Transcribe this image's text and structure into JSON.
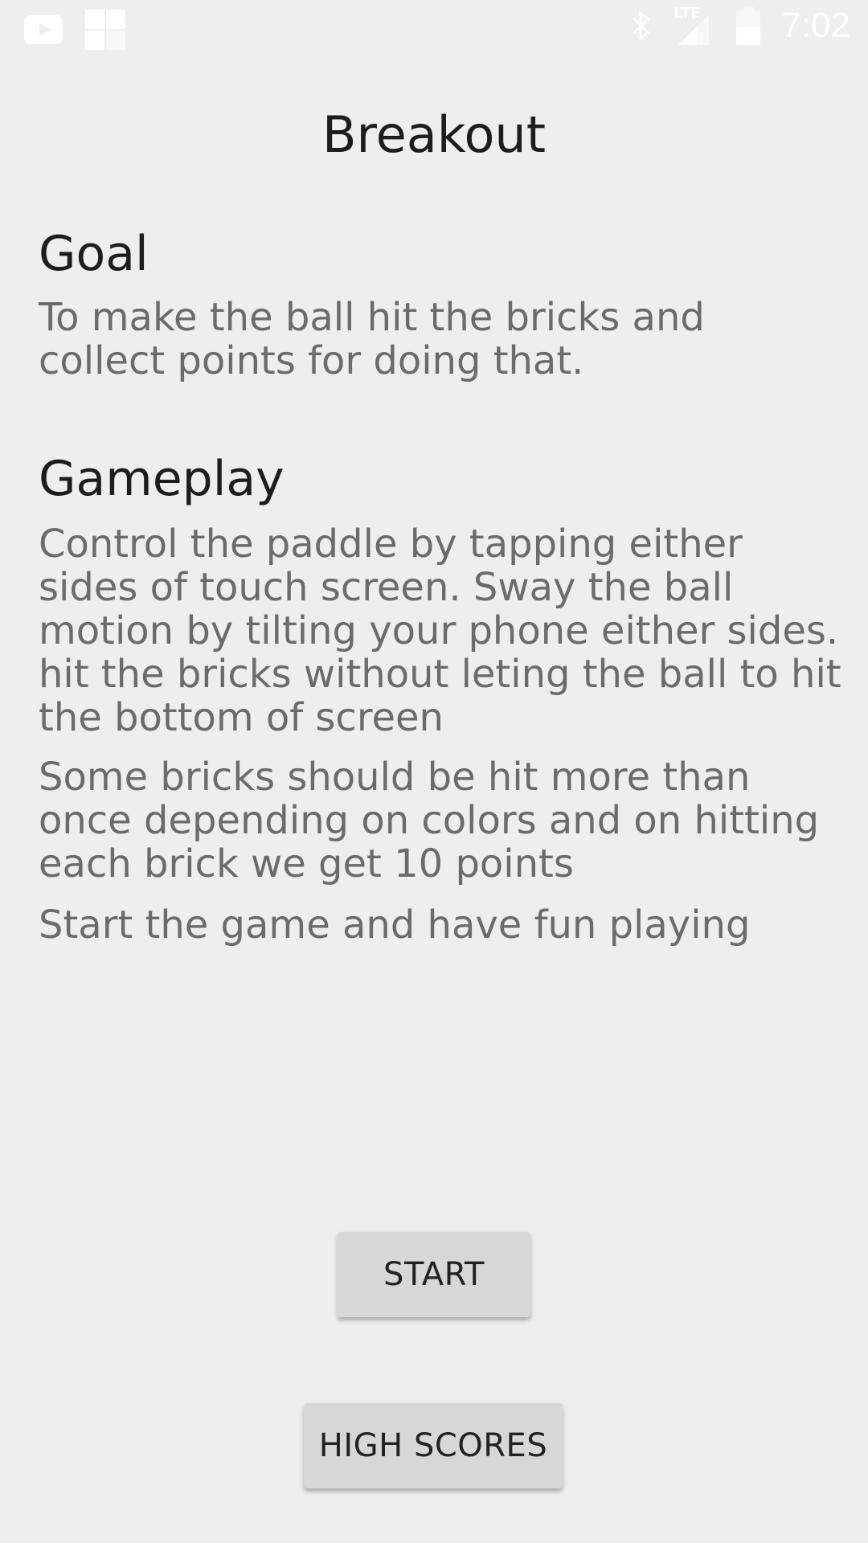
{
  "status_bar": {
    "time": "7:02",
    "network_label": "LTE",
    "icons": [
      "youtube-icon",
      "game-notification-icon",
      "bluetooth-icon",
      "lte-signal-icon",
      "battery-icon"
    ],
    "icon_color": "#ffffff"
  },
  "page": {
    "title": "Breakout"
  },
  "goal": {
    "heading": "Goal",
    "text": "To make the ball hit the bricks and collect points for doing that."
  },
  "gameplay": {
    "heading": "Gameplay",
    "paragraphs": [
      "Control the paddle by tapping either sides of touch screen. Sway the ball motion by tilting your phone either sides. hit the bricks without leting the ball to hit the bottom of screen",
      "Some bricks should be hit more than once depending on colors and on hitting each brick we get 10 points",
      "Start the game and have fun playing"
    ]
  },
  "buttons": {
    "start_label": "START",
    "high_scores_label": "HIGH SCORES"
  },
  "colors": {
    "background": "#eeeeee",
    "heading_text": "#1d1d1d",
    "body_text": "#6b6b6b",
    "button_bg": "#d7d7d7"
  }
}
